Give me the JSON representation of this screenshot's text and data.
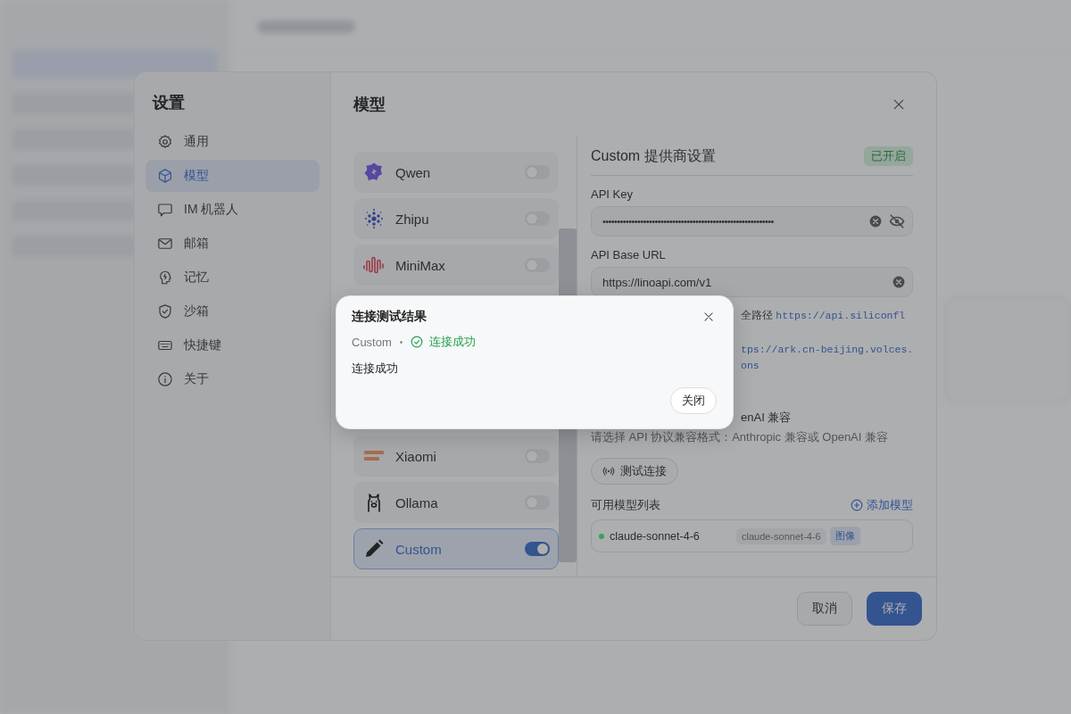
{
  "settings": {
    "title": "设置",
    "nav": [
      {
        "label": "通用",
        "selected": false
      },
      {
        "label": "模型",
        "selected": true
      },
      {
        "label": "IM 机器人",
        "selected": false
      },
      {
        "label": "邮箱",
        "selected": false
      },
      {
        "label": "记忆",
        "selected": false
      },
      {
        "label": "沙箱",
        "selected": false
      },
      {
        "label": "快捷键",
        "selected": false
      },
      {
        "label": "关于",
        "selected": false
      }
    ],
    "section_title": "模型",
    "providers": [
      {
        "name": "Qwen",
        "on": false,
        "selected": false
      },
      {
        "name": "Zhipu",
        "on": false,
        "selected": false
      },
      {
        "name": "MiniMax",
        "on": false,
        "selected": false
      },
      {
        "name": "Xiaomi",
        "on": false,
        "selected": false
      },
      {
        "name": "Ollama",
        "on": false,
        "selected": false
      },
      {
        "name": "Custom",
        "on": true,
        "selected": true
      }
    ],
    "provider_panel": {
      "title": "Custom 提供商设置",
      "status": "已开启",
      "api_key": {
        "label": "API Key",
        "value": "•••••••••••••••••••••••••••••••••••••••••••••••••••••••••••"
      },
      "base_url": {
        "label": "API Base URL",
        "value": "https://linoapi.com/v1"
      },
      "hint_1": {
        "text": "全路径",
        "link": "https://api.siliconfl"
      },
      "hint_2_link": "tps://ark.cn-beijing.volces.",
      "hint_3_link": "ons",
      "format_label": "enAI 兼容",
      "format_hint": "请选择 API 协议兼容格式：Anthropic 兼容或 OpenAI 兼容",
      "test_button": "测试连接",
      "models_title": "可用模型列表",
      "add_model": "添加模型",
      "models": [
        {
          "name": "claude-sonnet-4-6",
          "id_tag": "claude-sonnet-4-6",
          "capability": "图像",
          "color": "#35a356"
        }
      ]
    },
    "footer_buttons": [
      {
        "label": "取消",
        "kind": "secondary"
      },
      {
        "label": "保存",
        "kind": "primary"
      }
    ]
  },
  "dialog": {
    "title": "连接测试结果",
    "provider": "Custom",
    "separator": "•",
    "status": "连接成功",
    "message": "连接成功",
    "button": "关闭"
  }
}
